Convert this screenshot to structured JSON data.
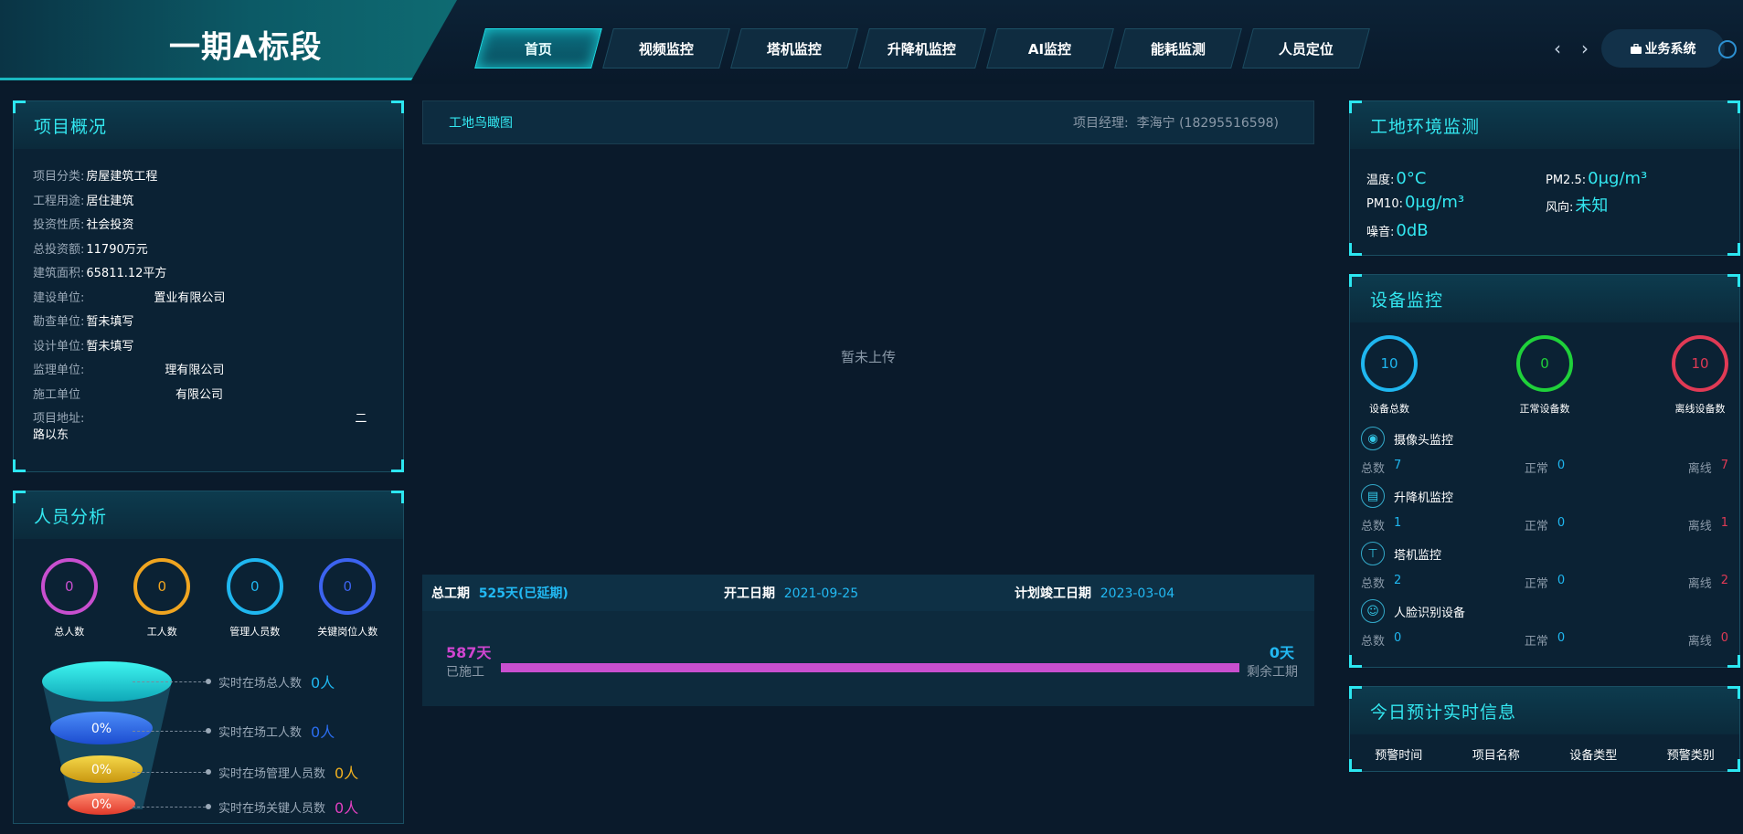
{
  "header": {
    "title": "一期A标段",
    "nav": [
      "首页",
      "视频监控",
      "塔机监控",
      "升降机监控",
      "AI监控",
      "能耗监测",
      "人员定位"
    ],
    "active_tab": "首页",
    "prev_icon": "‹",
    "next_icon": "›",
    "business_btn": "业务系统"
  },
  "overview": {
    "title": "项目概况",
    "rows": [
      {
        "k": "项目分类:",
        "v": "房屋建筑工程"
      },
      {
        "k": "工程用途:",
        "v": "居住建筑"
      },
      {
        "k": "投资性质:",
        "v": "社会投资"
      },
      {
        "k": "总投资额:",
        "v": "11790万元"
      },
      {
        "k": "建筑面积:",
        "v": "65811.12平方"
      },
      {
        "k": "建设单位:",
        "v": "置业有限公司"
      },
      {
        "k": "勘查单位:",
        "v": "暂未填写"
      },
      {
        "k": "设计单位:",
        "v": "暂未填写"
      },
      {
        "k": "监理单位:",
        "v": "理有限公司"
      },
      {
        "k": "施工单位",
        "v": "有限公司"
      },
      {
        "k": "项目地址:",
        "v": "二"
      }
    ],
    "address_line2": "路以东"
  },
  "personnel": {
    "title": "人员分析",
    "circles": [
      {
        "value": "0",
        "label": "总人数",
        "color": "#c84fcf"
      },
      {
        "value": "0",
        "label": "工人数",
        "color": "#f0a520"
      },
      {
        "value": "0",
        "label": "管理人员数",
        "color": "#1fb7f0"
      },
      {
        "value": "0",
        "label": "关键岗位人数",
        "color": "#3c63f0"
      }
    ],
    "funnel": [
      {
        "pct": "",
        "label": "实时在场总人数",
        "num": "0人",
        "color": "#1fb7f0"
      },
      {
        "pct": "0%",
        "label": "实时在场工人数",
        "num": "0人",
        "color": "#2a6df0"
      },
      {
        "pct": "0%",
        "label": "实时在场管理人员数",
        "num": "0人",
        "color": "#f0b020"
      },
      {
        "pct": "0%",
        "label": "实时在场关键人员数",
        "num": "0人",
        "color": "#e040c0"
      }
    ]
  },
  "center": {
    "birdseye_title": "工地鸟瞰图",
    "manager_label": "项目经理:",
    "manager_value": "李海宁 (18295516598)",
    "empty_text": "暂未上传",
    "total_period_label": "总工期",
    "total_period_value": "525天(已延期)",
    "start_label": "开工日期",
    "start_value": "2021-09-25",
    "plan_end_label": "计划竣工日期",
    "plan_end_value": "2023-03-04",
    "built_days": "587天",
    "built_label": "已施工",
    "remaining_days": "0天",
    "remaining_label": "剩余工期",
    "progress": 1.0
  },
  "environment": {
    "title": "工地环境监测",
    "items": [
      {
        "k": "温度:",
        "v": "0°C"
      },
      {
        "k": "PM2.5:",
        "v": "0μg/m³"
      },
      {
        "k": "PM10:",
        "v": "0μg/m³"
      },
      {
        "k": "风向:",
        "v": "未知"
      },
      {
        "k": "噪音:",
        "v": "0dB"
      }
    ]
  },
  "devices": {
    "title": "设备监控",
    "summary": [
      {
        "value": "10",
        "label": "设备总数",
        "color": "#1fb7f0"
      },
      {
        "value": "0",
        "label": "正常设备数",
        "color": "#1fd13a"
      },
      {
        "value": "10",
        "label": "离线设备数",
        "color": "#e03a55"
      }
    ],
    "total_label": "总数",
    "normal_label": "正常",
    "offline_label": "离线",
    "groups": [
      {
        "name": "摄像头监控",
        "icon": "camera-icon",
        "total": "7",
        "normal": "0",
        "offline": "7"
      },
      {
        "name": "升降机监控",
        "icon": "elevator-icon",
        "total": "1",
        "normal": "0",
        "offline": "1"
      },
      {
        "name": "塔机监控",
        "icon": "tower-crane-icon",
        "total": "2",
        "normal": "0",
        "offline": "2"
      },
      {
        "name": "人脸识别设备",
        "icon": "face-id-icon",
        "total": "0",
        "normal": "0",
        "offline": "0"
      }
    ]
  },
  "alarm": {
    "title": "今日预计实时信息",
    "columns": [
      "预警时间",
      "项目名称",
      "设备类型",
      "预警类别"
    ]
  }
}
